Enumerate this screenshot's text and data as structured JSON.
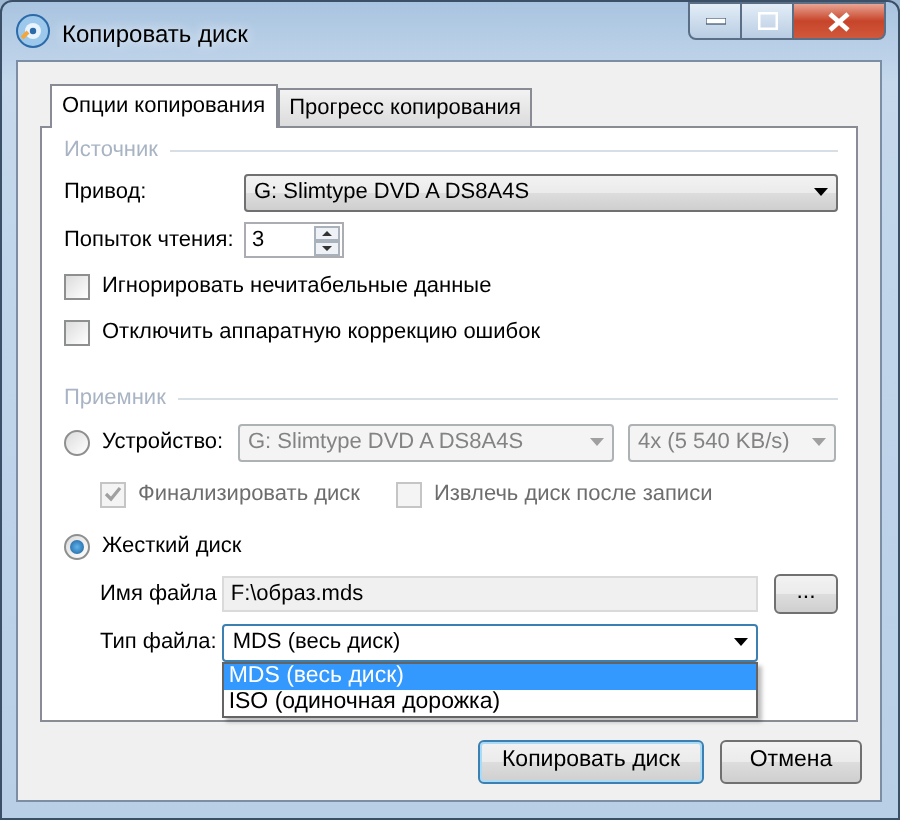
{
  "window": {
    "title": "Копировать диск"
  },
  "tabs": [
    {
      "label": "Опции копирования",
      "selected": true
    },
    {
      "label": "Прогресс копирования",
      "selected": false
    }
  ],
  "source": {
    "heading": "Источник",
    "drive": {
      "label": "Привод:",
      "value": "G: Slimtype DVD A DS8A4S"
    },
    "retries": {
      "label": "Попыток чтения:",
      "value": "3"
    },
    "options": [
      {
        "label": "Игнорировать нечитабельные данные",
        "checked": false
      },
      {
        "label": "Отключить аппаратную коррекцию ошибок",
        "checked": false
      }
    ]
  },
  "target": {
    "heading": "Приемник",
    "modes": [
      {
        "label": "Устройство:",
        "selected": false
      },
      {
        "label": "Жесткий диск",
        "selected": true
      }
    ],
    "device": {
      "value": "G: Slimtype DVD A DS8A4S",
      "speed": "4x (5 540 KB/s)",
      "disabled": true
    },
    "device_options": [
      {
        "label": "Финализировать диск",
        "checked": true,
        "disabled": true
      },
      {
        "label": "Извлечь диск после записи",
        "checked": false,
        "disabled": true
      }
    ],
    "file_name": {
      "label": "Имя файла",
      "value": "F:\\образ.mds",
      "browse": "..."
    },
    "file_type": {
      "label": "Тип файла:",
      "value": "MDS (весь диск)",
      "expanded": true,
      "options": [
        {
          "label": "MDS (весь диск)",
          "selected": true
        },
        {
          "label": "ISO (одиночная дорожка)",
          "selected": false
        }
      ]
    }
  },
  "buttons": [
    {
      "label": "Копировать диск",
      "default": true
    },
    {
      "label": "Отмена",
      "default": false
    }
  ]
}
